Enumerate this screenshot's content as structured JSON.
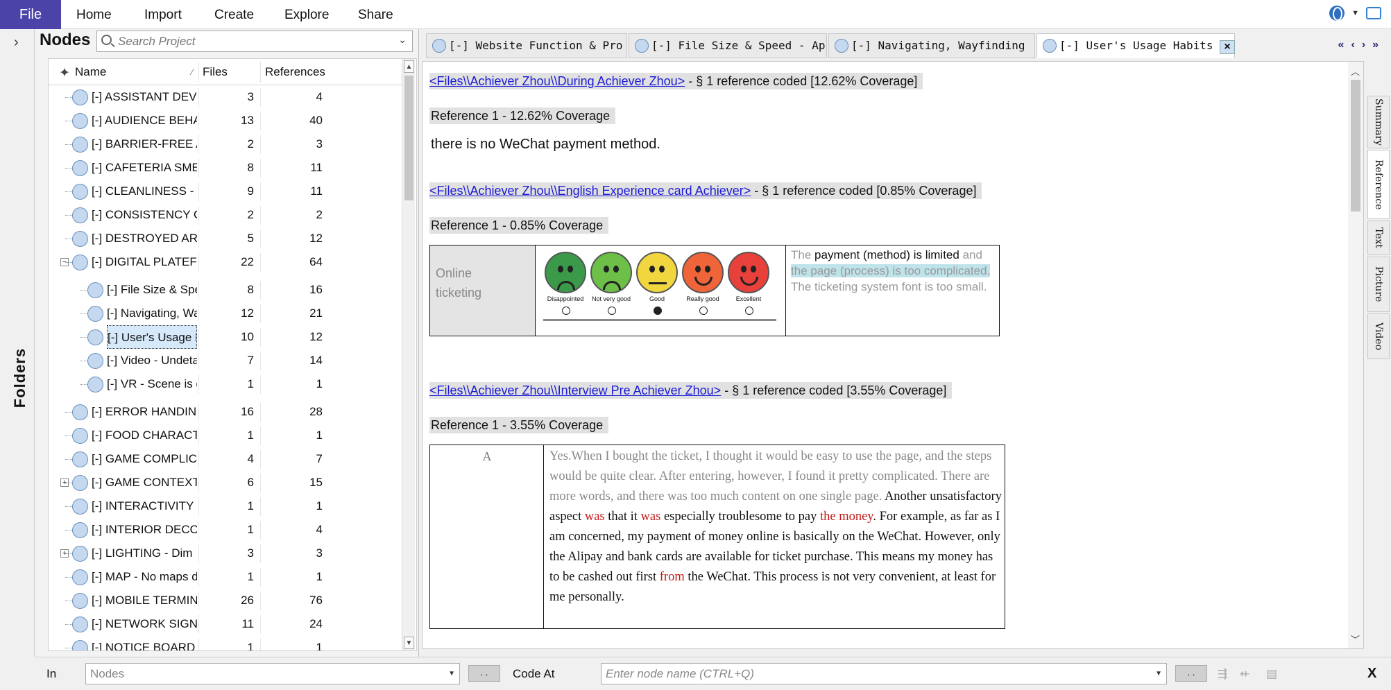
{
  "menubar": {
    "file": "File",
    "items": [
      "Home",
      "Import",
      "Create",
      "Explore",
      "Share"
    ]
  },
  "folders": {
    "label": "Folders"
  },
  "nodes_panel": {
    "title": "Nodes",
    "search_placeholder": "Search Project",
    "columns": {
      "name": "Name",
      "files": "Files",
      "references": "References"
    },
    "rows": [
      {
        "name": "[-] ASSISTANT DEVICE -",
        "files": "3",
        "refs": "4",
        "level": 0,
        "expander": ""
      },
      {
        "name": "[-] AUDIENCE BEHAVIO",
        "files": "13",
        "refs": "40",
        "level": 0,
        "expander": ""
      },
      {
        "name": "[-] BARRIER-FREE ACCE",
        "files": "2",
        "refs": "3",
        "level": 0,
        "expander": ""
      },
      {
        "name": "[-] CAFETERIA SMELL -",
        "files": "8",
        "refs": "11",
        "level": 0,
        "expander": ""
      },
      {
        "name": "[-] CLEANLINESS - Poor",
        "files": "9",
        "refs": "11",
        "level": 0,
        "expander": ""
      },
      {
        "name": "[-] CONSISTENCY ONLI",
        "files": "2",
        "refs": "2",
        "level": 0,
        "expander": ""
      },
      {
        "name": "[-] DESTROYED ARCHIT",
        "files": "5",
        "refs": "12",
        "level": 0,
        "expander": ""
      },
      {
        "name": "[-] DIGITAL PLATEFORM",
        "files": "22",
        "refs": "64",
        "level": 0,
        "expander": "−"
      },
      {
        "name": "[-] File Size & Speed",
        "files": "8",
        "refs": "16",
        "level": 1,
        "expander": ""
      },
      {
        "name": "[-] Navigating, Wayfi",
        "files": "12",
        "refs": "21",
        "level": 1,
        "expander": ""
      },
      {
        "name": "[-] User's Usage Hab",
        "files": "10",
        "refs": "12",
        "level": 1,
        "expander": "",
        "selected": true
      },
      {
        "name": "[-] Video - Undetaile",
        "files": "7",
        "refs": "14",
        "level": 1,
        "expander": ""
      },
      {
        "name": "[-] VR - Scene is dim",
        "files": "1",
        "refs": "1",
        "level": 1,
        "expander": ""
      },
      {
        "name": "[-] ERROR HANDING -",
        "files": "16",
        "refs": "28",
        "level": 0,
        "expander": ""
      },
      {
        "name": "[-] FOOD CHARACTERIS",
        "files": "1",
        "refs": "1",
        "level": 0,
        "expander": ""
      },
      {
        "name": "[-] GAME COMPLICATE",
        "files": "4",
        "refs": "7",
        "level": 0,
        "expander": ""
      },
      {
        "name": "[-] GAME CONTEXT",
        "files": "6",
        "refs": "15",
        "level": 0,
        "expander": "+"
      },
      {
        "name": "[-] INTERACTIVITY - No",
        "files": "1",
        "refs": "1",
        "level": 0,
        "expander": ""
      },
      {
        "name": "[-] INTERIOR DECORATI",
        "files": "1",
        "refs": "4",
        "level": 0,
        "expander": ""
      },
      {
        "name": "[-] LIGHTING - Dim",
        "files": "3",
        "refs": "3",
        "level": 0,
        "expander": "+"
      },
      {
        "name": "[-] MAP - No maps distr",
        "files": "1",
        "refs": "1",
        "level": 0,
        "expander": ""
      },
      {
        "name": "[-] MOBILE TERMINATIO",
        "files": "26",
        "refs": "76",
        "level": 0,
        "expander": ""
      },
      {
        "name": "[-] NETWORK SIGNAL -",
        "files": "11",
        "refs": "24",
        "level": 0,
        "expander": ""
      },
      {
        "name": "[-] NOTICE BOARD - Ins",
        "files": "1",
        "refs": "1",
        "level": 0,
        "expander": ""
      }
    ]
  },
  "tabs": [
    {
      "label": "[-] Website Function & Pro",
      "active": false
    },
    {
      "label": "[-] File Size & Speed - Ap",
      "active": false
    },
    {
      "label": "[-] Navigating, Wayfinding",
      "active": false
    },
    {
      "label": "[-] User's Usage Habits -",
      "active": true
    }
  ],
  "tab_close": "×",
  "nav_buttons": "«‹›»",
  "document": {
    "sections": [
      {
        "link": "<Files\\\\Achiever Zhou\\\\During Achiever Zhou>",
        "summary": "- § 1 reference coded  [12.62% Coverage]",
        "reference": "Reference 1 - 12.62% Coverage",
        "text": "there is no WeChat payment method."
      },
      {
        "link": "<Files\\\\Achiever Zhou\\\\English Experience card Achiever>",
        "summary": "- § 1 reference coded  [0.85% Coverage]",
        "reference": "Reference 1 - 0.85% Coverage"
      },
      {
        "link": "<Files\\\\Achiever Zhou\\\\Interview Pre Achiever Zhou>",
        "summary": "- § 1 reference coded  [3.55% Coverage]",
        "reference": "Reference 1 - 3.55% Coverage"
      }
    ],
    "card": {
      "label": "Online ticketing",
      "ratings": [
        "Disappointed",
        "Not very good",
        "Good",
        "Really good",
        "Excellent"
      ],
      "selected_rating": "Good",
      "emoji_colors": [
        "#3a9a4a",
        "#6cc048",
        "#f2d640",
        "#f0643a",
        "#e8403a"
      ],
      "text_pre": "The ",
      "text_black": "payment (method) is limited",
      "text_mid": " and ",
      "text_highlight": "the page (process) is too complicated.",
      "text_post": " The ticketing system font is too small."
    },
    "interview": {
      "speaker": "A",
      "gray_text": "Yes.When I bought the ticket, I thought it would be easy to use the page, and the steps would be quite clear. After entering, however, I found it pretty complicated. There are more words, and there was too much content on one single page.",
      "black_text_1": " Another unsatisfactory aspect ",
      "red_1": "was",
      "black_text_2": " that it ",
      "red_2": "was",
      "black_text_3": " especially troublesome to pay ",
      "red_3": "the money",
      "black_text_4": ". For example, as far as I am concerned, my payment of money online is basically on the WeChat. However, only the Alipay and bank cards are available for ticket purchase. This means my money has to be cashed out first ",
      "red_4": "from",
      "black_text_5": " the WeChat. This process is not very convenient, at least for me personally."
    },
    "lang": "EN"
  },
  "side_tabs": [
    "Summary",
    "Reference",
    "Text",
    "Picture",
    "Video"
  ],
  "side_tab_active": "Reference",
  "bottom_bar": {
    "in_label": "In",
    "in_value": "Nodes",
    "dots": ". .",
    "code_at": "Code At",
    "node_placeholder": "Enter node name (CTRL+Q)",
    "close": "X"
  }
}
